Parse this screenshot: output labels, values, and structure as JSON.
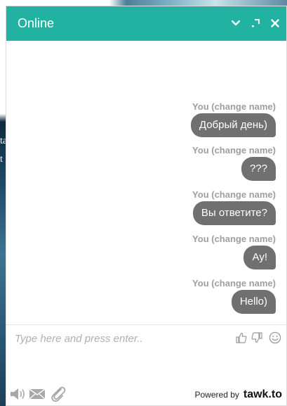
{
  "background": {
    "fragment_1": "ta",
    "fragment_2": "t"
  },
  "header": {
    "title": "Online",
    "color": "#22b2a1",
    "icons": [
      "chevron-down-icon",
      "popout-icon",
      "close-icon"
    ]
  },
  "messages": [
    {
      "sender": "You (change name)",
      "text": "Добрый день)"
    },
    {
      "sender": "You (change name)",
      "text": "???"
    },
    {
      "sender": "You (change name)",
      "text": "Вы ответите?"
    },
    {
      "sender": "You (change name)",
      "text": "Ау!"
    },
    {
      "sender": "You (change name)",
      "text": "Hello)"
    }
  ],
  "composer": {
    "placeholder": "Type here and press enter..",
    "value": ""
  },
  "footer": {
    "powered_label": "Powered by",
    "brand": "tawk.to"
  }
}
